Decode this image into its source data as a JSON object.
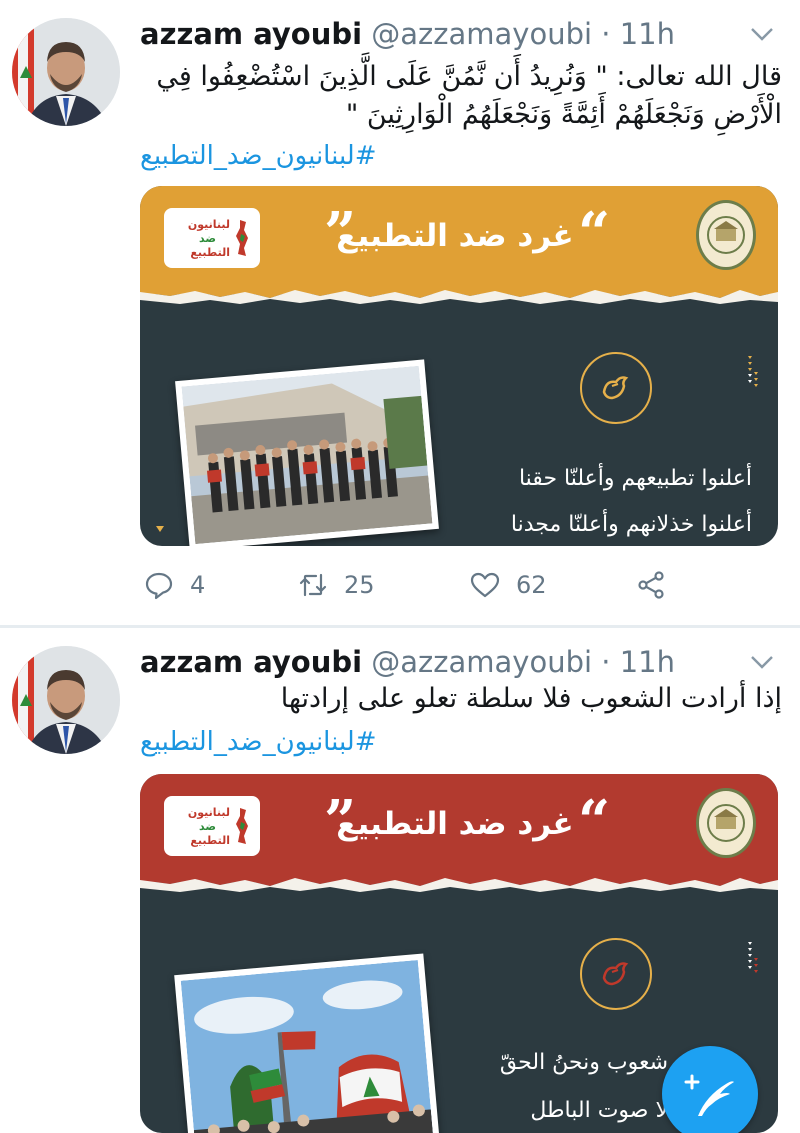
{
  "colors": {
    "name": "#14171a",
    "muted": "#657786",
    "link": "#1b95e0",
    "card_dark": "#2c3a40",
    "banner_orange": "#e0a035",
    "banner_red": "#b23a2f",
    "accent_gold": "#e6b04a",
    "fab_blue": "#1da1f2"
  },
  "tweets": [
    {
      "author_name": "azzam ayoubi",
      "handle": "@azzamayoubi",
      "separator": "·",
      "time": "11h",
      "text_line1": "قال الله تعالى: \" وَنُرِيدُ أَن نَّمُنَّ عَلَى الَّذِينَ اسْتُضْعِفُوا فِي",
      "text_line2": "الْأَرْضِ وَنَجْعَلَهُمْ أَئِمَّةً وَنَجْعَلَهُمُ الْوَارِثِينَ \"",
      "hashtag": "#لبنانيون_ضد_التطبيع",
      "card": {
        "banner_title": "غرد ضد التطبيع",
        "logo_text": [
          "لبنانيون",
          "ضد",
          "التطبيع"
        ],
        "slogan1": "أعلنوا تطبيعهم وأعلنّا حقنا",
        "slogan2": "أعلنوا خذلانهم وأعلنّا مجدنا",
        "icon_left": "campaign-logo-icon",
        "icon_right": "university-seal-icon",
        "icon_center": "dove-icon"
      },
      "actions": {
        "reply_count": "4",
        "retweet_count": "25",
        "like_count": "62"
      }
    },
    {
      "author_name": "azzam ayoubi",
      "handle": "@azzamayoubi",
      "separator": "·",
      "time": "11h",
      "text_line1": "إذا أرادت الشعوب فلا سلطة تعلو على إرادتها",
      "hashtag": "#لبنانيون_ضد_التطبيع",
      "card": {
        "banner_title": "غرد ضد التطبيع",
        "logo_text": [
          "لبنانيون",
          "ضد",
          "التطبيع"
        ],
        "slogan1": "شعوب ونحنُ الحقّ",
        "slogan2": "لا صوت الباطل",
        "icon_left": "campaign-logo-icon",
        "icon_right": "university-seal-icon",
        "icon_center": "dove-icon"
      }
    }
  ],
  "icons": {
    "reply": "reply-icon",
    "retweet": "retweet-icon",
    "like": "heart-icon",
    "share": "share-icon",
    "more": "chevron-down-icon",
    "compose": "compose-tweet-icon"
  }
}
